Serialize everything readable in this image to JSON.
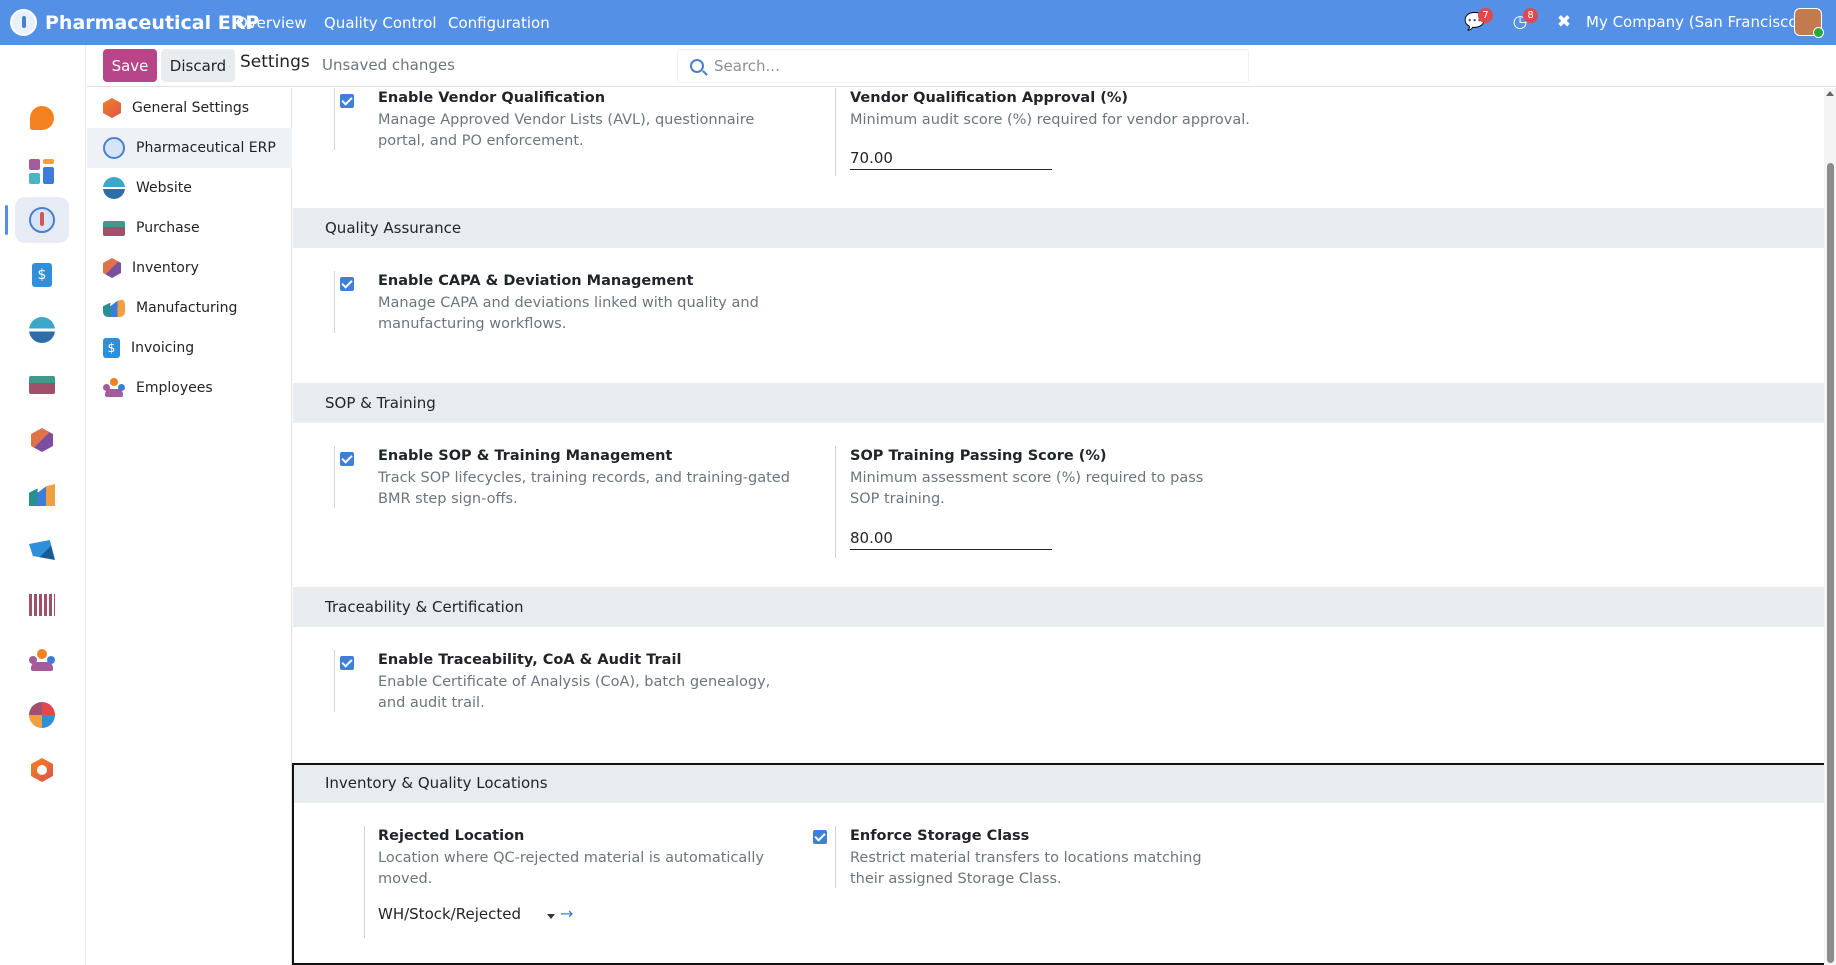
{
  "navbar": {
    "brand": "Pharmaceutical ERP",
    "menu": [
      "Overview",
      "Quality Control",
      "Configuration"
    ],
    "messages_count": "7",
    "activities_count": "8",
    "company": "My Company (San Francisco)"
  },
  "control_panel": {
    "save_label": "Save",
    "discard_label": "Discard",
    "title": "Settings",
    "status": "Unsaved changes",
    "search_placeholder": "Search..."
  },
  "sidebar": {
    "items": [
      {
        "label": "General Settings",
        "icon": "settings-hex-icon"
      },
      {
        "label": "Pharmaceutical ERP",
        "icon": "pharma-erp-icon",
        "active": true
      },
      {
        "label": "Website",
        "icon": "website-icon"
      },
      {
        "label": "Purchase",
        "icon": "purchase-icon"
      },
      {
        "label": "Inventory",
        "icon": "inventory-icon"
      },
      {
        "label": "Manufacturing",
        "icon": "manufacturing-icon"
      },
      {
        "label": "Invoicing",
        "icon": "invoicing-icon"
      },
      {
        "label": "Employees",
        "icon": "employees-icon"
      }
    ]
  },
  "sections": {
    "vendor": {
      "enable_title": "Enable Vendor Qualification",
      "enable_desc": "Manage Approved Vendor Lists (AVL), questionnaire portal, and PO enforcement.",
      "approval_title": "Vendor Qualification Approval (%)",
      "approval_desc": "Minimum audit score (%) required for vendor approval.",
      "approval_value": "70.00"
    },
    "qa": {
      "heading": "Quality Assurance",
      "enable_title": "Enable CAPA & Deviation Management",
      "enable_desc": "Manage CAPA and deviations linked with quality and manufacturing workflows."
    },
    "sop": {
      "heading": "SOP & Training",
      "enable_title": "Enable SOP & Training Management",
      "enable_desc": "Track SOP lifecycles, training records, and training-gated BMR step sign-offs.",
      "score_title": "SOP Training Passing Score (%)",
      "score_desc": "Minimum assessment score (%) required to pass SOP training.",
      "score_value": "80.00"
    },
    "trace": {
      "heading": "Traceability & Certification",
      "enable_title": "Enable Traceability, CoA & Audit Trail",
      "enable_desc": "Enable Certificate of Analysis (CoA), batch genealogy, and audit trail."
    },
    "locations": {
      "heading": "Inventory & Quality Locations",
      "rejected_title": "Rejected Location",
      "rejected_desc": "Location where QC-rejected material is automatically moved.",
      "rejected_value": "WH/Stock/Rejected",
      "storage_title": "Enforce Storage Class",
      "storage_desc": "Restrict material transfers to locations matching their assigned Storage Class."
    }
  },
  "colors": {
    "navbar": "#5491E6",
    "save_button": "#B8448A",
    "checkbox": "#3f7fd9"
  }
}
